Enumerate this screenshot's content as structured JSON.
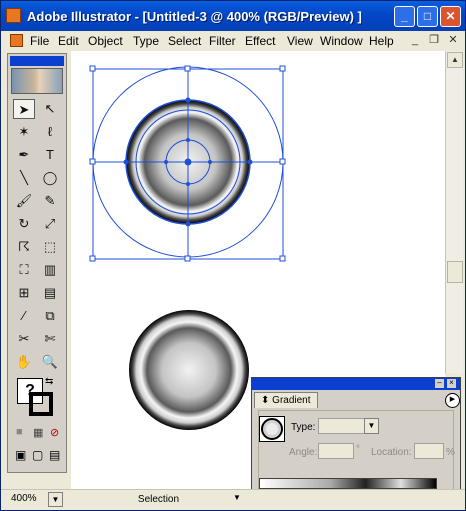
{
  "window": {
    "title": "Adobe Illustrator - [Untitled-3 @ 400% (RGB/Preview) ]",
    "minimize_glyph": "_",
    "maximize_glyph": "□",
    "close_glyph": "✕"
  },
  "menu": {
    "items": [
      "File",
      "Edit",
      "Object",
      "Type",
      "Select",
      "Filter",
      "Effect",
      "View",
      "Window",
      "Help"
    ],
    "doc_min_glyph": "_",
    "doc_restore_glyph": "❐",
    "doc_close_glyph": "✕"
  },
  "toolbox": {
    "tools": [
      {
        "name": "selection-tool-icon",
        "glyph": "➤",
        "selected": true
      },
      {
        "name": "direct-selection-tool-icon",
        "glyph": "↖"
      },
      {
        "name": "magic-wand-tool-icon",
        "glyph": "✶"
      },
      {
        "name": "lasso-tool-icon",
        "glyph": "ℓ"
      },
      {
        "name": "pen-tool-icon",
        "glyph": "✒"
      },
      {
        "name": "type-tool-icon",
        "glyph": "T"
      },
      {
        "name": "line-tool-icon",
        "glyph": "╲"
      },
      {
        "name": "ellipse-tool-icon",
        "glyph": "◯"
      },
      {
        "name": "paintbrush-tool-icon",
        "glyph": "🖌"
      },
      {
        "name": "pencil-tool-icon",
        "glyph": "✎"
      },
      {
        "name": "rotate-tool-icon",
        "glyph": "↻"
      },
      {
        "name": "scale-tool-icon",
        "glyph": "⤢"
      },
      {
        "name": "warp-tool-icon",
        "glyph": "☈"
      },
      {
        "name": "free-transform-tool-icon",
        "glyph": "⬚"
      },
      {
        "name": "symbol-sprayer-tool-icon",
        "glyph": "⛶"
      },
      {
        "name": "graph-tool-icon",
        "glyph": "▥"
      },
      {
        "name": "mesh-tool-icon",
        "glyph": "⊞"
      },
      {
        "name": "gradient-tool-icon",
        "glyph": "▤"
      },
      {
        "name": "eyedropper-tool-icon",
        "glyph": "⁄"
      },
      {
        "name": "blend-tool-icon",
        "glyph": "⧉"
      },
      {
        "name": "slice-tool-icon",
        "glyph": "✂"
      },
      {
        "name": "scissors-tool-icon",
        "glyph": "✄"
      },
      {
        "name": "hand-tool-icon",
        "glyph": "✋"
      },
      {
        "name": "zoom-tool-icon",
        "glyph": "🔍"
      }
    ],
    "fill_glyph": "?",
    "swap_glyph": "⇆",
    "color_glyph": "■",
    "gradient_glyph": "▦",
    "none_glyph": "⊘",
    "screen_glyphs": [
      "▣",
      "▢",
      "▤"
    ]
  },
  "status": {
    "zoom": "400%",
    "tool": "Selection"
  },
  "gradient_panel": {
    "tab": "Gradient",
    "type_label": "Type:",
    "type_value": "",
    "angle_label": "Angle:",
    "angle_unit": "°",
    "location_label": "Location:",
    "location_unit": "%"
  },
  "colors": {
    "titlebar": "#0348c8",
    "selection": "#1f4fd8",
    "panel": "#d4d0c8"
  }
}
